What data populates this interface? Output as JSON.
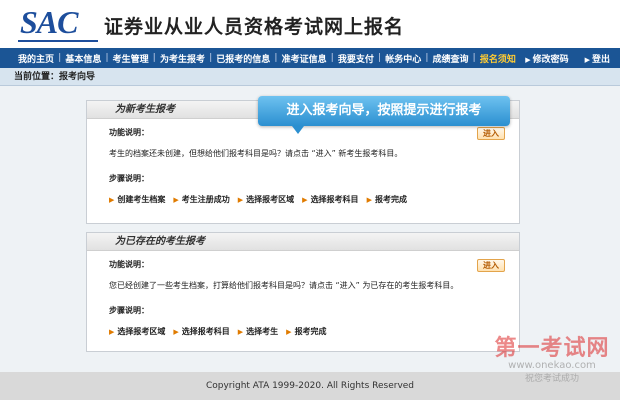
{
  "header": {
    "logo": "SAC",
    "title": "证券业从业人员资格考试网上报名"
  },
  "nav": {
    "items": [
      {
        "label": "我的主页"
      },
      {
        "label": "基本信息"
      },
      {
        "label": "考生管理"
      },
      {
        "label": "为考生报考"
      },
      {
        "label": "已报考的信息"
      },
      {
        "label": "准考证信息"
      },
      {
        "label": "我要支付"
      },
      {
        "label": "帐务中心"
      },
      {
        "label": "成绩查询"
      },
      {
        "label": "报名须知"
      }
    ],
    "right": [
      {
        "label": "修改密码"
      },
      {
        "label": "登出"
      }
    ]
  },
  "breadcrumb": "当前位置：报考向导",
  "tooltip": "进入报考向导，按照提示进行报考",
  "panel_new": {
    "title": "为新考生报考",
    "func_label": "功能说明：",
    "desc": "考生的档案还未创建，但想给他们报考科目是吗？请点击 “进入” 新考生报考科目。",
    "steps_label": "步骤说明：",
    "steps": [
      "创建考生档案",
      "考生注册成功",
      "选择报考区域",
      "选择报考科目",
      "报考完成"
    ],
    "enter": "进入"
  },
  "panel_existing": {
    "title": "为已存在的考生报考",
    "func_label": "功能说明：",
    "desc": "您已经创建了一些考生档案，打算给他们报考科目是吗？请点击 “进入” 为已存在的考生报考科目。",
    "steps_label": "步骤说明：",
    "steps": [
      "选择报考区域",
      "选择报考科目",
      "选择考生",
      "报考完成"
    ],
    "enter": "进入"
  },
  "footer": "Copyright ATA 1999-2020. All Rights Reserved",
  "watermark": {
    "title": "第一考试网",
    "url": "www.onekao.com",
    "slogan": "祝您考试成功"
  },
  "colors": {
    "nav_bg": "#1b5595",
    "nav_active": "#ffcc33",
    "accent_orange": "#e07b00",
    "tooltip_bg": "#2b8fd0"
  }
}
